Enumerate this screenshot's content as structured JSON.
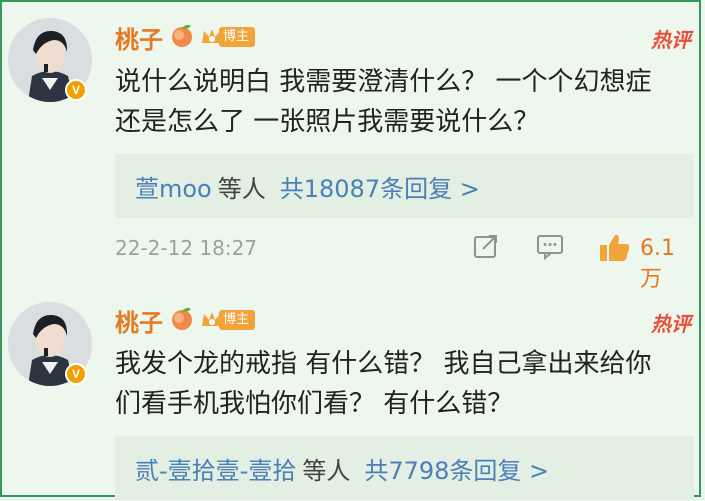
{
  "colors": {
    "username": "#e67a22",
    "hot": "#e8503b",
    "link": "#4a7fb8",
    "accent": "#f1a43a"
  },
  "comments": [
    {
      "username": "桃子",
      "badge": "博主",
      "hot_label": "热评",
      "content": "说什么说明白 我需要澄清什么？ 一个个幻想症还是怎么了 一张照片我需要说什么？",
      "reply_names": "萱moo",
      "reply_suffix": "等人",
      "reply_count": "共18087条回复 >",
      "timestamp": "22-2-12 18:27",
      "likes": "6.1万"
    },
    {
      "username": "桃子",
      "badge": "博主",
      "hot_label": "热评",
      "content": "我发个龙的戒指 有什么错？ 我自己拿出来给你们看手机我怕你们看？ 有什么错？",
      "reply_names": "贰-壹拾壹-壹拾",
      "reply_suffix": "等人",
      "reply_count": "共7798条回复 >"
    }
  ],
  "icons": {
    "verified": "V",
    "share": "share-icon",
    "comment": "comment-icon",
    "like": "thumbs-up-icon"
  }
}
